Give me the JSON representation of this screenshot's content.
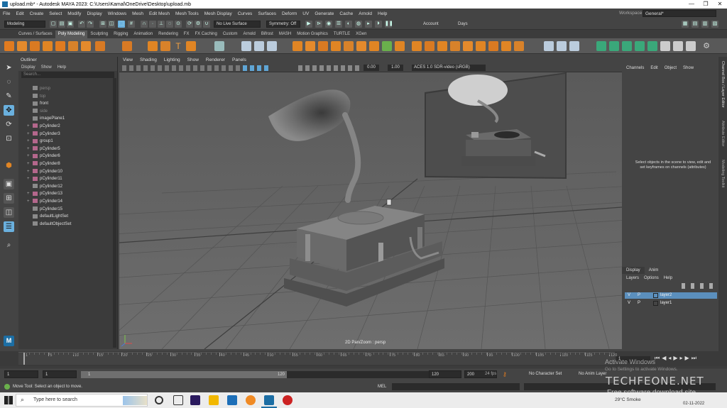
{
  "window": {
    "title": "upload.mb* - Autodesk MAYA 2023: C:\\Users\\Kamal\\OneDrive\\Desktop\\upload.mb",
    "minimize": "—",
    "restore": "❐",
    "close": "✕"
  },
  "menubar": {
    "items": [
      "File",
      "Edit",
      "Create",
      "Select",
      "Modify",
      "Display",
      "Windows",
      "Mesh",
      "Edit Mesh",
      "Mesh Tools",
      "Mesh Display",
      "Curves",
      "Surfaces",
      "Deform",
      "UV",
      "Generate",
      "Cache",
      "Arnold",
      "Help"
    ],
    "workspace_label": "Workspace :",
    "workspace_value": "General*"
  },
  "statusline": {
    "mode": "Modeling",
    "live_surface": "No Live Surface",
    "symmetry": "Symmetry: Off",
    "account": "Account",
    "days": "Days"
  },
  "shelf": {
    "tabs": [
      "Curves / Surfaces",
      "Poly Modeling",
      "Sculpting",
      "Rigging",
      "Animation",
      "Rendering",
      "FX",
      "FX Caching",
      "Custom",
      "Arnold",
      "Bifrost",
      "MASH",
      "Motion Graphics",
      "TURTLE",
      "XGen"
    ],
    "active_tab": "Poly Modeling"
  },
  "outliner": {
    "title": "Outliner",
    "menu": [
      "Display",
      "Show",
      "Help"
    ],
    "search_placeholder": "Search...",
    "items": [
      {
        "label": "persp",
        "dim": true,
        "expand": ""
      },
      {
        "label": "top",
        "dim": true,
        "expand": ""
      },
      {
        "label": "front",
        "dim": false,
        "expand": ""
      },
      {
        "label": "side",
        "dim": true,
        "expand": ""
      },
      {
        "label": "imagePlane1",
        "dim": false,
        "expand": ""
      },
      {
        "label": "pCylinder2",
        "dim": false,
        "expand": "+"
      },
      {
        "label": "pCylinder3",
        "dim": false,
        "expand": "+"
      },
      {
        "label": "group1",
        "dim": false,
        "expand": "+"
      },
      {
        "label": "pCylinder5",
        "dim": false,
        "expand": "+"
      },
      {
        "label": "pCylinder6",
        "dim": false,
        "expand": "+"
      },
      {
        "label": "pCylinder8",
        "dim": false,
        "expand": "+"
      },
      {
        "label": "pCylinder10",
        "dim": false,
        "expand": "+"
      },
      {
        "label": "pCylinder11",
        "dim": false,
        "expand": "+"
      },
      {
        "label": "pCylinder12",
        "dim": false,
        "expand": ""
      },
      {
        "label": "pCylinder13",
        "dim": false,
        "expand": "+"
      },
      {
        "label": "pCylinder14",
        "dim": false,
        "expand": "+"
      },
      {
        "label": "pCylinder15",
        "dim": false,
        "expand": ""
      },
      {
        "label": "defaultLightSet",
        "dim": false,
        "expand": ""
      },
      {
        "label": "defaultObjectSet",
        "dim": false,
        "expand": ""
      }
    ]
  },
  "viewport": {
    "menu": [
      "View",
      "Shading",
      "Lighting",
      "Show",
      "Renderer",
      "Panels"
    ],
    "exposure": "0.00",
    "gamma": "1.00",
    "colorspace": "ACES 1.0 SDR-video (sRGB)",
    "camera_label": "2D Pan/Zoom : persp"
  },
  "channelbox": {
    "menu": [
      "Channels",
      "Edit",
      "Object",
      "Show"
    ],
    "message": "Select objects in the scene to view, edit and set keyframes on channels (attributes)"
  },
  "layers": {
    "tabs": [
      "Display",
      "Anim"
    ],
    "menu": [
      "Layers",
      "Options",
      "Help"
    ],
    "rows": [
      {
        "v": "V",
        "p": "P",
        "name": "layer2",
        "selected": true
      },
      {
        "v": "V",
        "p": "P",
        "name": "layer1",
        "selected": false
      }
    ]
  },
  "side_tabs": [
    "Channel Box / Layer Editor",
    "Attribute Editor",
    "Modeling Toolkit"
  ],
  "timeline": {
    "ticks": [
      "1",
      "5",
      "10",
      "15",
      "20",
      "25",
      "30",
      "35",
      "40",
      "45",
      "50",
      "55",
      "60",
      "65",
      "70",
      "75",
      "80",
      "85",
      "90",
      "95",
      "100",
      "105",
      "110",
      "115",
      "120"
    ],
    "current_frame": "1"
  },
  "range": {
    "start": "1",
    "start_inner": "1",
    "slider_start": "1",
    "slider_end": "120",
    "end_inner": "120",
    "end": "200",
    "fps": "24 fps",
    "char_set": "No Character Set",
    "anim_layer": "No Anim Layer"
  },
  "cmdline": {
    "help_text": "Move Tool: Select an object to move.",
    "mel_label": "MEL"
  },
  "taskbar": {
    "search_placeholder": "Type here to search",
    "weather": "29°C Smoke",
    "time": "02-11-2022"
  },
  "overlay": {
    "activate_title": "Activate Windows",
    "activate_sub": "Go to Settings to activate Windows.",
    "watermark": "TECHFEONE.NET",
    "watermark_sub": "Free software download site"
  },
  "colors": {
    "accent": "#6ab0de",
    "selected_layer": "#5b8fbd",
    "maya_blue": "#1c6ea4"
  }
}
